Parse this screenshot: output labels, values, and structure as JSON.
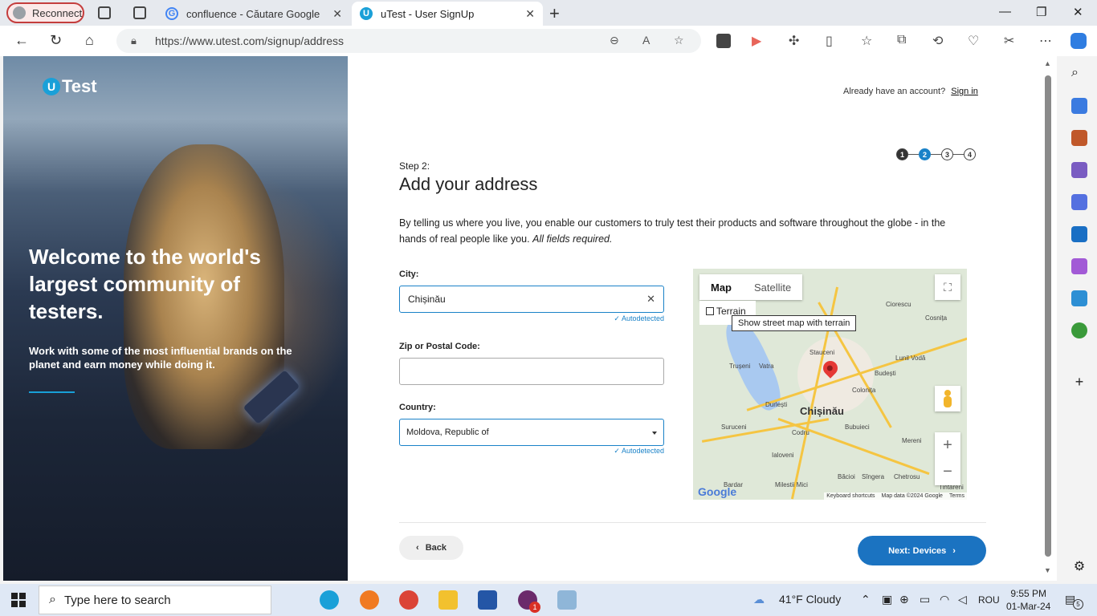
{
  "browser": {
    "reconnect_label": "Reconnect",
    "tabs": [
      {
        "title": "confluence - Căutare Google",
        "favicon": "G"
      },
      {
        "title": "uTest - User SignUp",
        "favicon": "U"
      }
    ],
    "url": "https://www.utest.com/signup/address"
  },
  "hero": {
    "logo_u": "U",
    "logo_text": "Test",
    "headline": "Welcome to the world's largest community of testers.",
    "subtext": "Work with some of the most influential brands on the planet and earn money while doing it."
  },
  "header": {
    "already_text": "Already have an account?",
    "signin_label": "Sign in"
  },
  "steps": [
    "1",
    "2",
    "3",
    "4"
  ],
  "form": {
    "step_label": "Step 2:",
    "title": "Add your address",
    "intro": "By telling us where you live, you enable our customers to truly test their products and software throughout the globe - in the hands of real people like you.",
    "intro_em": "All fields required.",
    "city_label": "City:",
    "city_value": "Chișinău",
    "autodetected": "✓ Autodetected",
    "zip_label": "Zip or Postal Code:",
    "zip_value": "",
    "country_label": "Country:",
    "country_value": "Moldova, Republic of"
  },
  "map": {
    "map_tab": "Map",
    "satellite_tab": "Satellite",
    "terrain_label": "Terrain",
    "tooltip": "Show street map with terrain",
    "city_label": "Chișinău",
    "places": [
      "Stauceni",
      "Trușeni",
      "Vatra",
      "Budești",
      "Colonița",
      "Durlești",
      "Suruceni",
      "Codru",
      "Bubuieci",
      "Ialoveni",
      "Mereni",
      "Băcioi",
      "Sîngera",
      "Chetrosu",
      "Bardar",
      "Milestii Mici",
      "Tintăreni",
      "Cosnița",
      "Ciorescu",
      "Lunil Vodă"
    ],
    "keyboard_shortcuts": "Keyboard shortcuts",
    "map_data": "Map data ©2024 Google",
    "terms": "Terms",
    "google_logo": "Google"
  },
  "actions": {
    "back_label": "Back",
    "next_label": "Next: Devices"
  },
  "taskbar": {
    "search_placeholder": "Type here to search",
    "weather": "41°F  Cloudy",
    "lang": "ROU",
    "time": "9:55 PM",
    "date": "01-Mar-24",
    "notif_count": "5",
    "slack_badge": "1"
  }
}
